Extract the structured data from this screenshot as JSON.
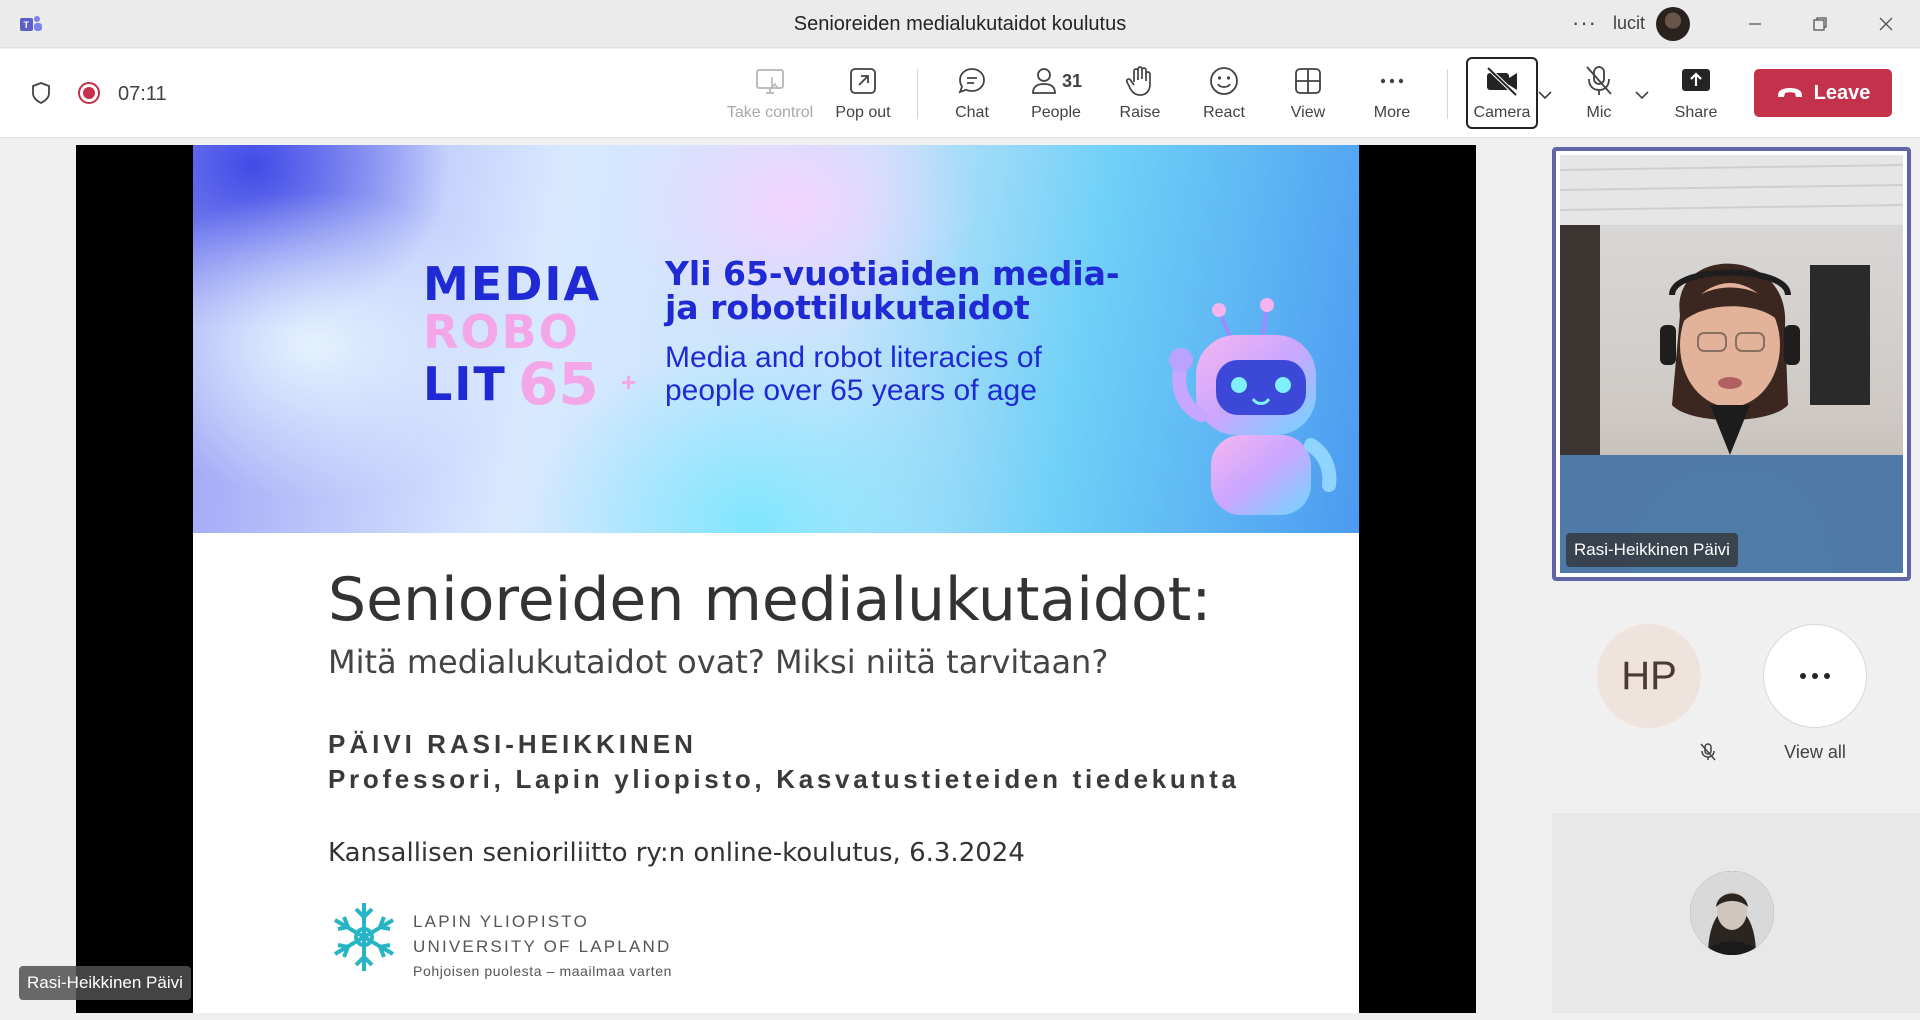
{
  "window": {
    "title": "Senioreiden medialukutaidot koulutus",
    "more_label": "···",
    "user": "lucit"
  },
  "toolbar": {
    "timer": "07:11",
    "take_control": "Take control",
    "pop_out": "Pop out",
    "chat": "Chat",
    "people": "People",
    "people_count": "31",
    "raise": "Raise",
    "react": "React",
    "view": "View",
    "more": "More",
    "camera": "Camera",
    "mic": "Mic",
    "share": "Share",
    "leave": "Leave"
  },
  "slide": {
    "logo_media": "MEDIA",
    "logo_robo": "ROBO",
    "logo_lit": "LIT",
    "logo_65": "65",
    "logo_plus": "+",
    "fi_title_1": "Yli 65-vuotiaiden media-",
    "fi_title_2": "ja robottilukutaidot",
    "en_title_1": "Media and robot literacies of",
    "en_title_2": "people over 65 years of age",
    "title": "Senioreiden medialukutaidot:",
    "subtitle": "Mitä medialukutaidot ovat? Miksi niitä tarvitaan?",
    "presenter_name": "PÄIVI RASI-HEIKKINEN",
    "presenter_role": "Professori, Lapin yliopisto, Kasvatustieteiden tiedekunta",
    "event": "Kansallisen senioriliitto ry:n online-koulutus, 6.3.2024",
    "uni_line1": "LAPIN YLIOPISTO",
    "uni_line2": "UNIVERSITY OF LAPLAND",
    "uni_line3": "Pohjoisen puolesta – maailmaa varten"
  },
  "stage": {
    "presenter_tag": "Rasi-Heikkinen Päivi"
  },
  "participants": {
    "speaker_name": "Rasi-Heikkinen Päivi",
    "hp_initials": "HP",
    "view_all": "View all"
  },
  "colors": {
    "accent": "#6264a7",
    "leave": "#c4314b",
    "record": "#c4314b",
    "slide_blue": "#1f2ad4",
    "slide_pink": "#f3a6e8"
  }
}
